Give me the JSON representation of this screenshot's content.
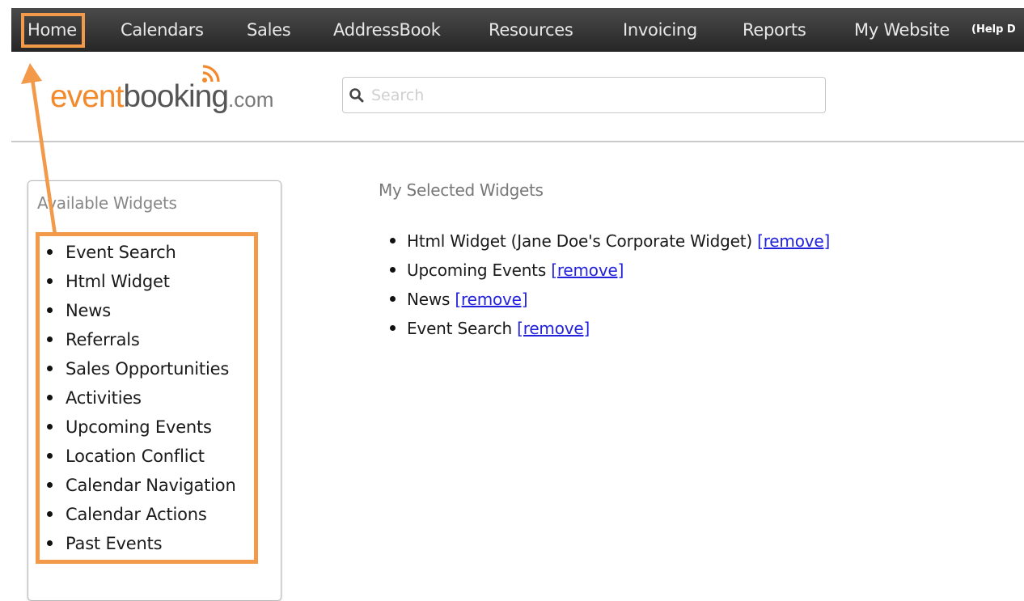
{
  "nav": {
    "items": [
      "Home",
      "Calendars",
      "Sales",
      "AddressBook",
      "Resources",
      "Invoicing",
      "Reports",
      "My Website"
    ],
    "help_label": "(Help D"
  },
  "logo": {
    "part1": "event",
    "part2": "booking",
    "part3": ".com",
    "icon": "rss-icon"
  },
  "search": {
    "placeholder": "Search",
    "value": "",
    "icon": "search-icon"
  },
  "available_widgets": {
    "title": "Available Widgets",
    "items": [
      "Event Search",
      "Html Widget",
      "News",
      "Referrals",
      "Sales Opportunities",
      "Activities",
      "Upcoming Events",
      "Location Conflict",
      "Calendar Navigation",
      "Calendar Actions",
      "Past Events"
    ]
  },
  "selected_widgets": {
    "title": "My Selected Widgets",
    "items": [
      {
        "label": "Html Widget (Jane Doe's Corporate Widget)",
        "action": "[remove]"
      },
      {
        "label": "Upcoming Events",
        "action": "[remove]"
      },
      {
        "label": "News",
        "action": "[remove]"
      },
      {
        "label": "Event Search",
        "action": "[remove]"
      }
    ]
  },
  "colors": {
    "highlight": "#f2994a",
    "nav_bg": "#333333",
    "link": "#2222dd",
    "logo_orange": "#f2892b"
  }
}
